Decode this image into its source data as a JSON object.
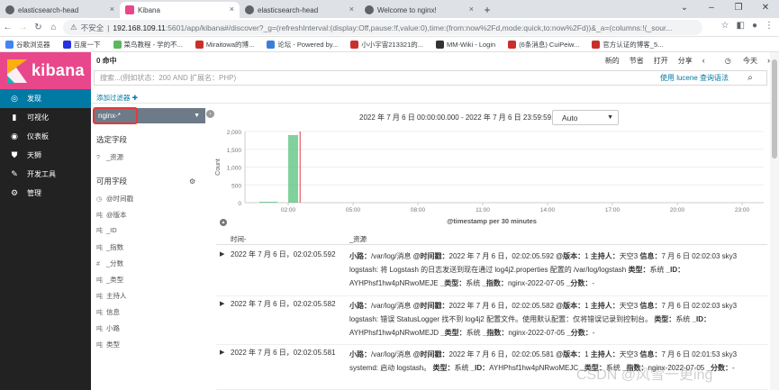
{
  "browser": {
    "tabs": [
      {
        "title": "elasticsearch-head",
        "active": false
      },
      {
        "title": "Kibana",
        "active": true
      },
      {
        "title": "elasticsearch-head",
        "active": false
      },
      {
        "title": "Welcome to nginx!",
        "active": false
      }
    ],
    "new_tab": "+",
    "address": {
      "security": "不安全",
      "host": "192.168.109.11",
      "path": ":5601/app/kibana#/discover?_g=(refreshInterval:(display:Off,pause:!f,value:0),time:(from:now%2Fd,mode:quick,to:now%2Fd))&_a=(columns:!(_sour..."
    },
    "bookmarks": [
      {
        "label": "谷歌浏览器",
        "color": "#4285f4"
      },
      {
        "label": "百度一下",
        "color": "#2932e1"
      },
      {
        "label": "菜鸟教程 - 学的不...",
        "color": "#5cb85c"
      },
      {
        "label": "Miraitowa的博...",
        "color": "#c9302c"
      },
      {
        "label": "论坛 - Powered by...",
        "color": "#3c7ed6"
      },
      {
        "label": "小小宇宙213321的...",
        "color": "#c9302c"
      },
      {
        "label": "MM-Wiki - Login",
        "color": "#333333"
      },
      {
        "label": "(6条消息) CuiPeiw...",
        "color": "#c9302c"
      },
      {
        "label": "官方认证的博客_5...",
        "color": "#c9302c"
      }
    ]
  },
  "kibana": {
    "brand": "kibana",
    "nav": [
      {
        "label": "发现",
        "icon": "compass-icon",
        "active": true
      },
      {
        "label": "可视化",
        "icon": "bar-chart-icon",
        "active": false
      },
      {
        "label": "仪表板",
        "icon": "dashboard-icon",
        "active": false
      },
      {
        "label": "天狮",
        "icon": "shield-icon",
        "active": false
      },
      {
        "label": "开发工具",
        "icon": "wrench-icon",
        "active": false
      },
      {
        "label": "管理",
        "icon": "gear-icon",
        "active": false
      }
    ],
    "hits": "0 命中",
    "toplinks": [
      "新的",
      "节省",
      "打开",
      "分享"
    ],
    "time_label": "今天",
    "query_placeholder": "搜索...(例如状态：200 AND 扩展名：PHP)",
    "lucene": "使用 lucene 查询语法",
    "add_filter": "添加过滤器 ✚",
    "index_pattern": "nginx-*",
    "selected_fields_title": "选定字段",
    "selected_fields": [
      {
        "type": "?",
        "name": "_资源"
      }
    ],
    "available_fields_title": "可用字段",
    "available_fields": [
      {
        "type": "◷",
        "name": "@时间戳"
      },
      {
        "type": "吨",
        "name": "@版本"
      },
      {
        "type": "吨",
        "name": "_ID"
      },
      {
        "type": "吨",
        "name": "_指数"
      },
      {
        "type": "#",
        "name": "_分数"
      },
      {
        "type": "吨",
        "name": "_类型"
      },
      {
        "type": "吨",
        "name": "主持人"
      },
      {
        "type": "吨",
        "name": "信息"
      },
      {
        "type": "吨",
        "name": "小路"
      },
      {
        "type": "吨",
        "name": "类型"
      }
    ],
    "time_range": "2022 年 7 月 6 日 00:00:00.000 - 2022 年 7 月 6 日 23:59:59.999 —",
    "interval": "Auto",
    "table_headers": {
      "time": "时间-",
      "source": "_资源"
    },
    "docs": [
      {
        "time": "2022 年 7 月 6 日，02:02:05.592",
        "source": [
          {
            "k": "小路：",
            "v": "/var/log/消息"
          },
          {
            "k": "@时间戳：",
            "v": "2022 年 7 月 6 日，02:02:05.592"
          },
          {
            "k": "@版本：",
            "v": "1"
          },
          {
            "k": "主持人：",
            "v": "天空3"
          },
          {
            "k": "信息：",
            "v": "7 月 6 日 02:02:03 sky3 logstash: 将 Logstash 的日志发送到现在通过 log4j2.properties 配置的 /var/log/logstash"
          },
          {
            "k": "类型：",
            "v": "系统"
          },
          {
            "k": "_ID：",
            "v": "AYHPhsf1hw4pNRwoMEJE"
          },
          {
            "k": "_类型：",
            "v": "系统"
          },
          {
            "k": "_指数：",
            "v": "nginx-2022-07-05"
          },
          {
            "k": "_分数：",
            "v": "-"
          }
        ]
      },
      {
        "time": "2022 年 7 月 6 日，02:02:05.582",
        "source": [
          {
            "k": "小路：",
            "v": "/var/log/消息"
          },
          {
            "k": "@时间戳：",
            "v": "2022 年 7 月 6 日，02:02:05.582"
          },
          {
            "k": "@版本：",
            "v": "1"
          },
          {
            "k": "主持人：",
            "v": "天空3"
          },
          {
            "k": "信息：",
            "v": "7 月 6 日 02:02:03 sky3 logstash: 错误 StatusLogger 找不到 log4j2 配置文件。使用默认配置：仅将错误记录到控制台。"
          },
          {
            "k": "类型：",
            "v": "系统"
          },
          {
            "k": "_ID：",
            "v": "AYHPhsf1hw4pNRwoMEJD"
          },
          {
            "k": "_类型：",
            "v": "系统"
          },
          {
            "k": "_指数：",
            "v": "nginx-2022-07-05"
          },
          {
            "k": "_分数：",
            "v": "-"
          }
        ]
      },
      {
        "time": "2022 年 7 月 6 日，02:02:05.581",
        "source": [
          {
            "k": "小路：",
            "v": "/var/log/消息"
          },
          {
            "k": "@时间戳：",
            "v": "2022 年 7 月 6 日，02:02:05.581"
          },
          {
            "k": "@版本：",
            "v": "1"
          },
          {
            "k": "主持人：",
            "v": "天空3"
          },
          {
            "k": "信息：",
            "v": "7 月 6 日 02:01:53 sky3 systemd: 启动 logstash。"
          },
          {
            "k": "类型：",
            "v": "系统"
          },
          {
            "k": "_ID：",
            "v": "AYHPhsf1hw4pNRwoMEJC"
          },
          {
            "k": "_类型：",
            "v": "系统"
          },
          {
            "k": "_指数：",
            "v": "nginx-2022-07-05"
          },
          {
            "k": "_分数：",
            "v": "-"
          }
        ]
      }
    ]
  },
  "chart_data": {
    "type": "bar",
    "x": [
      "00:00",
      "00:30",
      "01:00",
      "01:30",
      "02:00",
      "02:30"
    ],
    "values": [
      0,
      0,
      0,
      0,
      1900,
      0
    ],
    "yticks": [
      0,
      500,
      1000,
      1500,
      2000
    ],
    "ytick_labels": [
      "0",
      "500",
      "1,000",
      "1,500",
      "2,000"
    ],
    "ylim": [
      0,
      2000
    ],
    "xticks": [
      "02:00",
      "05:00",
      "08:00",
      "11:00",
      "14:00",
      "17:00",
      "20:00",
      "23:00"
    ],
    "ylabel": "Count",
    "xlabel": "@timestamp per 30 minutes",
    "current_time_marker": "02:30",
    "bar_color": "#57c17b",
    "marker_color": "#e4393c"
  },
  "watermark": "CSDN @风雪一更ing"
}
